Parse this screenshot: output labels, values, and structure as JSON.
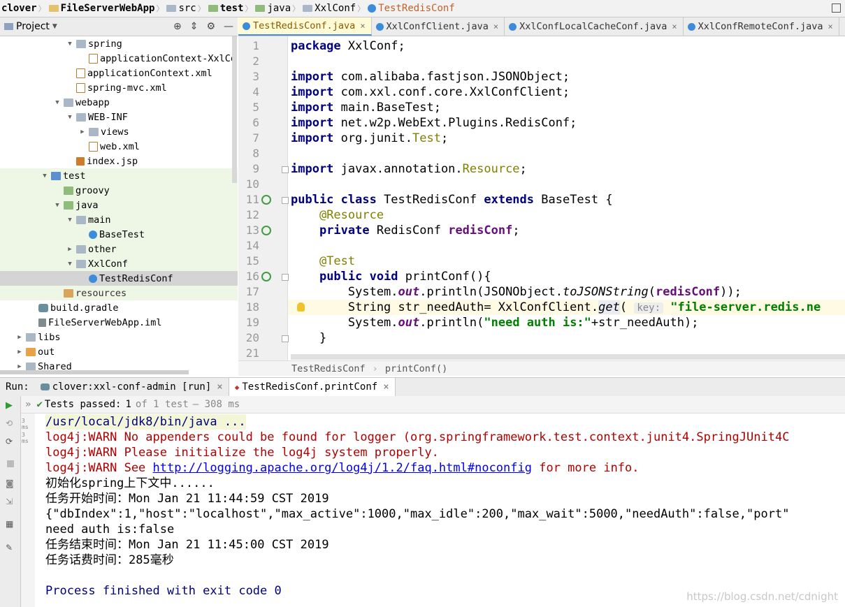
{
  "breadcrumb": [
    {
      "text": "clover",
      "bold": true,
      "color": "#e4c16b"
    },
    {
      "text": "FileServerWebApp",
      "bold": true,
      "color": "#e4c16b"
    },
    {
      "text": "src",
      "bold": false,
      "color": "#a9b7c6"
    },
    {
      "text": "test",
      "bold": true,
      "color": "#8fbc7a"
    },
    {
      "text": "java",
      "bold": false,
      "color": "#8fbc7a"
    },
    {
      "text": "XxlConf",
      "bold": false,
      "color": "#a9b7c6"
    },
    {
      "text": "TestRedisConf",
      "bold": false,
      "color": "#3d8cd9",
      "orange": true
    }
  ],
  "project_panel": {
    "label": "Project"
  },
  "tree": [
    {
      "text": "spring",
      "indent": 95,
      "arrow": "▼",
      "icon": "folder",
      "green": false
    },
    {
      "text": "applicationContext-XxlCo",
      "indent": 113,
      "arrow": "",
      "icon": "xml",
      "green": false
    },
    {
      "text": "applicationContext.xml",
      "indent": 95,
      "arrow": "",
      "icon": "xml",
      "green": false
    },
    {
      "text": "spring-mvc.xml",
      "indent": 95,
      "arrow": "",
      "icon": "xml",
      "green": false
    },
    {
      "text": "webapp",
      "indent": 77,
      "arrow": "▼",
      "icon": "folder",
      "green": false
    },
    {
      "text": "WEB-INF",
      "indent": 95,
      "arrow": "▼",
      "icon": "folder",
      "green": false
    },
    {
      "text": "views",
      "indent": 113,
      "arrow": "▶",
      "icon": "folder",
      "green": false
    },
    {
      "text": "web.xml",
      "indent": 113,
      "arrow": "",
      "icon": "xml",
      "green": false
    },
    {
      "text": "index.jsp",
      "indent": 95,
      "arrow": "",
      "icon": "jsp",
      "green": false
    },
    {
      "text": "test",
      "indent": 59,
      "arrow": "▼",
      "icon": "module",
      "green": true
    },
    {
      "text": "groovy",
      "indent": 77,
      "arrow": "",
      "icon": "folder-src",
      "green": true
    },
    {
      "text": "java",
      "indent": 77,
      "arrow": "▼",
      "icon": "folder-src",
      "green": true
    },
    {
      "text": "main",
      "indent": 95,
      "arrow": "▼",
      "icon": "folder",
      "green": true
    },
    {
      "text": "BaseTest",
      "indent": 113,
      "arrow": "",
      "icon": "cls",
      "green": true
    },
    {
      "text": "other",
      "indent": 95,
      "arrow": "▶",
      "icon": "folder",
      "green": true
    },
    {
      "text": "XxlConf",
      "indent": 95,
      "arrow": "▼",
      "icon": "folder",
      "green": true
    },
    {
      "text": "TestRedisConf",
      "indent": 113,
      "arrow": "",
      "icon": "cls",
      "green": true,
      "selected": true
    },
    {
      "text": "resources",
      "indent": 77,
      "arrow": "",
      "icon": "folder-res",
      "green": true
    },
    {
      "text": "build.gradle",
      "indent": 41,
      "arrow": "",
      "icon": "gradle",
      "green": false
    },
    {
      "text": "FileServerWebApp.iml",
      "indent": 41,
      "arrow": "",
      "icon": "iml",
      "green": false
    },
    {
      "text": "libs",
      "indent": 23,
      "arrow": "▶",
      "icon": "folder",
      "green": false
    },
    {
      "text": "out",
      "indent": 23,
      "arrow": "▶",
      "icon": "folder-out",
      "green": false
    },
    {
      "text": "Shared",
      "indent": 23,
      "arrow": "▶",
      "icon": "folder",
      "green": false
    }
  ],
  "tabs": [
    {
      "label": "TestRedisConf.java",
      "active": true
    },
    {
      "label": "XxlConfClient.java",
      "active": false
    },
    {
      "label": "XxlConfLocalCacheConf.java",
      "active": false
    },
    {
      "label": "XxlConfRemoteConf.java",
      "active": false
    }
  ],
  "editor": {
    "line_numbers": [
      "1",
      "2",
      "3",
      "4",
      "5",
      "6",
      "7",
      "8",
      "9",
      "10",
      "11",
      "12",
      "13",
      "14",
      "15",
      "16",
      "17",
      "18",
      "19",
      "20",
      "21"
    ],
    "lines": [
      [
        {
          "t": "package ",
          "c": "kw"
        },
        {
          "t": "XxlConf;",
          "c": ""
        }
      ],
      [],
      [
        {
          "t": "import ",
          "c": "kw"
        },
        {
          "t": "com.alibaba.fastjson.JSONObject;",
          "c": ""
        }
      ],
      [
        {
          "t": "import ",
          "c": "kw"
        },
        {
          "t": "com.xxl.conf.core.XxlConfClient;",
          "c": ""
        }
      ],
      [
        {
          "t": "import ",
          "c": "kw"
        },
        {
          "t": "main.BaseTest;",
          "c": ""
        }
      ],
      [
        {
          "t": "import ",
          "c": "kw"
        },
        {
          "t": "net.w2p.WebExt.Plugins.RedisConf;",
          "c": ""
        }
      ],
      [
        {
          "t": "import ",
          "c": "kw"
        },
        {
          "t": "org.junit.",
          "c": ""
        },
        {
          "t": "Test",
          "c": "ann"
        },
        {
          "t": ";",
          "c": ""
        }
      ],
      [],
      [
        {
          "t": "import ",
          "c": "kw"
        },
        {
          "t": "javax.annotation.",
          "c": ""
        },
        {
          "t": "Resource",
          "c": "ann"
        },
        {
          "t": ";",
          "c": ""
        }
      ],
      [],
      [
        {
          "t": "public class ",
          "c": "kw"
        },
        {
          "t": "TestRedisConf ",
          "c": ""
        },
        {
          "t": "extends ",
          "c": "kw"
        },
        {
          "t": "BaseTest {",
          "c": ""
        }
      ],
      [
        {
          "t": "    ",
          "c": ""
        },
        {
          "t": "@Resource",
          "c": "ann"
        }
      ],
      [
        {
          "t": "    ",
          "c": ""
        },
        {
          "t": "private ",
          "c": "kw"
        },
        {
          "t": "RedisConf ",
          "c": ""
        },
        {
          "t": "redisConf",
          "c": "fld"
        },
        {
          "t": ";",
          "c": ""
        }
      ],
      [],
      [
        {
          "t": "    ",
          "c": ""
        },
        {
          "t": "@Test",
          "c": "ann"
        }
      ],
      [
        {
          "t": "    ",
          "c": ""
        },
        {
          "t": "public void ",
          "c": "kw"
        },
        {
          "t": "printConf(){",
          "c": ""
        }
      ],
      [
        {
          "t": "        System.",
          "c": ""
        },
        {
          "t": "out",
          "c": "itfld"
        },
        {
          "t": ".println(JSONObject.",
          "c": ""
        },
        {
          "t": "toJSONString",
          "c": "ital"
        },
        {
          "t": "(",
          "c": ""
        },
        {
          "t": "redisConf",
          "c": "fld"
        },
        {
          "t": "));",
          "c": ""
        }
      ],
      [
        {
          "t": "        String str_needAuth= XxlConfClient.",
          "c": ""
        },
        {
          "t": "get",
          "c": "ital getbg"
        },
        {
          "t": "( ",
          "c": ""
        },
        {
          "t": "key:",
          "c": "hint"
        },
        {
          "t": " ",
          "c": ""
        },
        {
          "t": "\"file-server.redis.ne",
          "c": "str"
        }
      ],
      [
        {
          "t": "        System.",
          "c": ""
        },
        {
          "t": "out",
          "c": "itfld"
        },
        {
          "t": ".println(",
          "c": ""
        },
        {
          "t": "\"need auth is:\"",
          "c": "str"
        },
        {
          "t": "+str_needAuth);",
          "c": ""
        }
      ],
      [
        {
          "t": "    }",
          "c": ""
        }
      ],
      []
    ],
    "highlight_line": 18,
    "breadcrumb": [
      "TestRedisConf",
      "printConf()"
    ]
  },
  "run": {
    "label": "Run:",
    "tab1": "clover:xxl-conf-admin [run]",
    "tab2": "TestRedisConf.printConf",
    "tests_passed": "Tests passed:",
    "tests_count": "1",
    "tests_of": "of 1 test",
    "tests_time": "— 308 ms",
    "durations": [
      "3 ms",
      "3 ms"
    ]
  },
  "console": [
    {
      "t": "/usr/local/jdk8/bin/java ...",
      "c": "c-cmd"
    },
    {
      "t": "log4j:WARN No appenders could be found for logger (org.springframework.test.context.junit4.SpringJUnit4C",
      "c": "c-warn"
    },
    {
      "t": "log4j:WARN Please initialize the log4j system properly.",
      "c": "c-warn"
    },
    {
      "parts": [
        {
          "t": "log4j:WARN See ",
          "c": "c-warn"
        },
        {
          "t": "http://logging.apache.org/log4j/1.2/faq.html#noconfig",
          "c": "c-link"
        },
        {
          "t": " for more info.",
          "c": "c-warn"
        }
      ]
    },
    {
      "t": "初始化spring上下文中......",
      "c": ""
    },
    {
      "t": "任务开始时间：Mon Jan 21 11:44:59 CST 2019",
      "c": ""
    },
    {
      "t": "{\"dbIndex\":1,\"host\":\"localhost\",\"max_active\":1000,\"max_idle\":200,\"max_wait\":5000,\"needAuth\":false,\"port\"",
      "c": ""
    },
    {
      "t": "need auth is:false",
      "c": ""
    },
    {
      "t": "任务结束时间：Mon Jan 21 11:45:00 CST 2019",
      "c": ""
    },
    {
      "t": "任务话费时间：285毫秒",
      "c": ""
    },
    {
      "t": "",
      "c": ""
    },
    {
      "t": "Process finished with exit code 0",
      "c": "c-exit"
    }
  ],
  "watermark": "https://blog.csdn.net/cdnight"
}
